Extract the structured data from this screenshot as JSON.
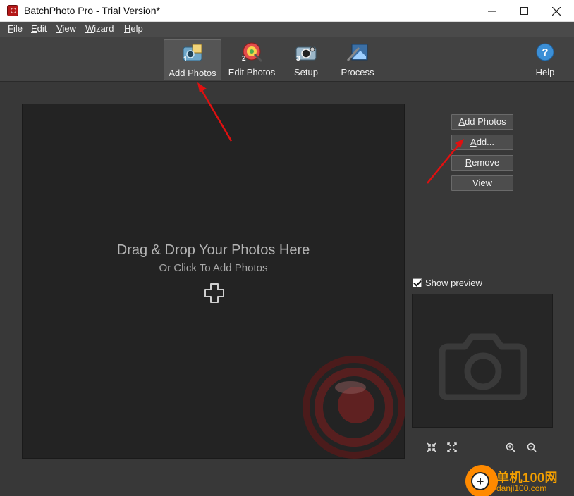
{
  "window": {
    "title": "BatchPhoto Pro - Trial Version*"
  },
  "menu": [
    {
      "u": "F",
      "rest": "ile"
    },
    {
      "u": "E",
      "rest": "dit"
    },
    {
      "u": "V",
      "rest": "iew"
    },
    {
      "u": "W",
      "rest": "izard"
    },
    {
      "u": "H",
      "rest": "elp"
    }
  ],
  "toolbar": {
    "add_photos": {
      "step": "1",
      "label": "Add Photos"
    },
    "edit_photos": {
      "step": "2",
      "label": "Edit Photos"
    },
    "setup": {
      "step": "3",
      "label": "Setup"
    },
    "process": {
      "label": "Process"
    },
    "help": {
      "label": "Help"
    }
  },
  "drop_area": {
    "title": "Drag & Drop Your Photos Here",
    "subtitle": "Or Click To Add Photos"
  },
  "side_buttons": {
    "add_photos": {
      "u": "A",
      "rest": "dd Photos"
    },
    "add": {
      "u": "A",
      "rest": "dd..."
    },
    "remove": {
      "u": "R",
      "rest": "emove"
    },
    "view": {
      "u": "V",
      "rest": "iew"
    }
  },
  "preview": {
    "label_u": "S",
    "label_rest": "how preview",
    "checked": true
  },
  "watermark": {
    "name": "单机100网",
    "url": "danji100.com"
  },
  "colors": {
    "accent_arrow": "#e01010",
    "brand_red": "#b41818",
    "watermark_orange": "#f4a000"
  }
}
